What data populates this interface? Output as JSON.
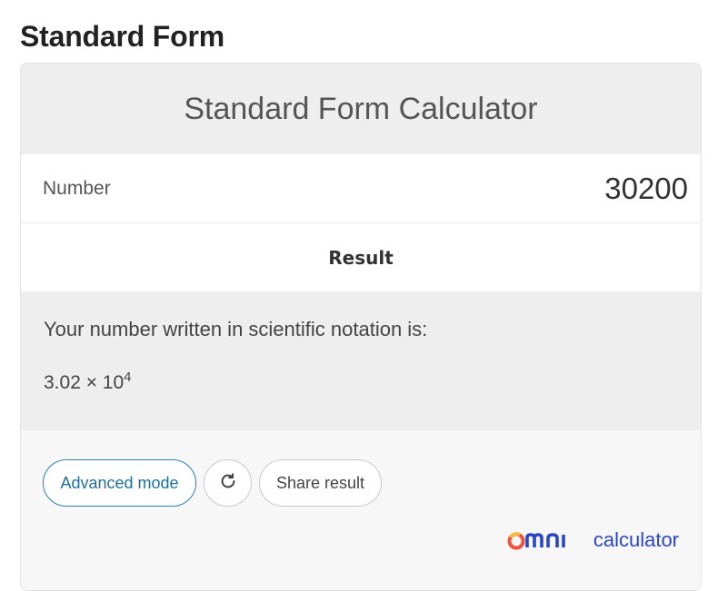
{
  "page": {
    "heading": "Standard Form"
  },
  "calculator": {
    "title": "Standard Form Calculator",
    "number_label": "Number",
    "number_value": "30200",
    "result_title": "Result",
    "result_text": "Your number written in scientific notation is:",
    "result_mantissa": "3.02 × 10",
    "result_exponent": "4"
  },
  "buttons": {
    "advanced_mode": "Advanced mode",
    "reload_icon": "reload-icon",
    "share_result": "Share result"
  },
  "brand": {
    "omni": "omni",
    "calculator": "calculator",
    "color": "#2a46c4"
  }
}
